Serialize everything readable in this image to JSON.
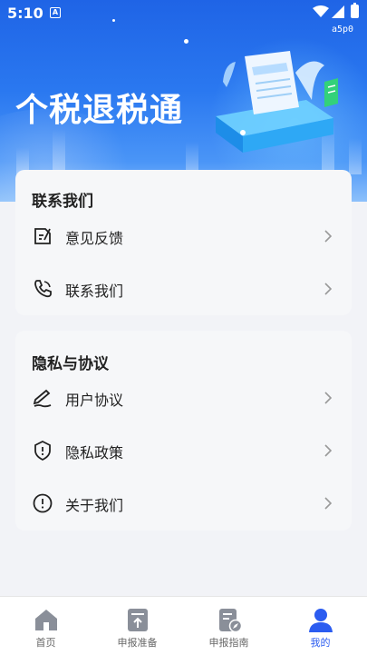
{
  "status_bar": {
    "time": "5:10",
    "notification_icon": "A",
    "tag": "a5p0"
  },
  "banner": {
    "title": "个税退税通"
  },
  "contact_section": {
    "title": "联系我们",
    "items": [
      {
        "label": "意见反馈",
        "icon": "feedback-icon"
      },
      {
        "label": "联系我们",
        "icon": "phone-icon"
      }
    ]
  },
  "privacy_section": {
    "title": "隐私与协议",
    "items": [
      {
        "label": "用户协议",
        "icon": "signature-icon"
      },
      {
        "label": "隐私政策",
        "icon": "shield-icon"
      },
      {
        "label": "关于我们",
        "icon": "info-icon"
      }
    ]
  },
  "tabbar": {
    "items": [
      {
        "label": "首页",
        "icon": "home-icon"
      },
      {
        "label": "申报准备",
        "icon": "upload-doc-icon"
      },
      {
        "label": "申报指南",
        "icon": "guide-doc-icon"
      },
      {
        "label": "我的",
        "icon": "user-icon"
      }
    ],
    "active_index": 3
  },
  "colors": {
    "accent": "#2b5cf0",
    "banner_top": "#1f64e6",
    "background": "#f2f3f7"
  }
}
